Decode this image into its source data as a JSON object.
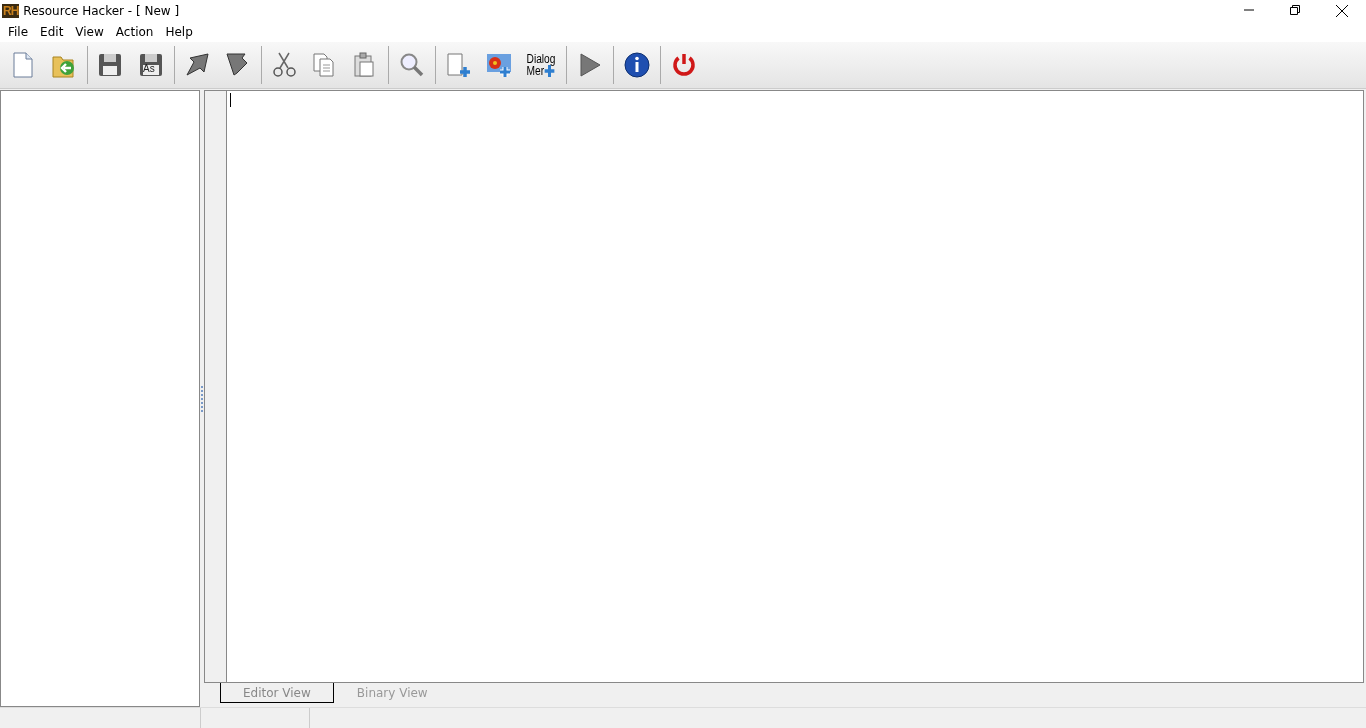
{
  "window": {
    "title": "Resource Hacker - [ New ]",
    "logo": "RH"
  },
  "menu": [
    {
      "label": "File"
    },
    {
      "label": "Edit"
    },
    {
      "label": "View"
    },
    {
      "label": "Action"
    },
    {
      "label": "Help"
    }
  ],
  "toolbar": [
    [
      {
        "kind": "new"
      },
      {
        "kind": "open"
      }
    ],
    [
      {
        "kind": "save"
      },
      {
        "kind": "saveas",
        "label": "As"
      }
    ],
    [
      {
        "kind": "import"
      },
      {
        "kind": "export"
      }
    ],
    [
      {
        "kind": "cut"
      },
      {
        "kind": "copy"
      },
      {
        "kind": "paste"
      }
    ],
    [
      {
        "kind": "find"
      }
    ],
    [
      {
        "kind": "addblank"
      },
      {
        "kind": "addimage"
      },
      {
        "kind": "adddialog",
        "label": "Dialog",
        "label2": "Mer"
      }
    ],
    [
      {
        "kind": "run"
      }
    ],
    [
      {
        "kind": "info"
      }
    ],
    [
      {
        "kind": "exit"
      }
    ]
  ],
  "tabs": [
    {
      "label": "Editor View",
      "selected": true
    },
    {
      "label": "Binary View",
      "selected": false
    }
  ]
}
